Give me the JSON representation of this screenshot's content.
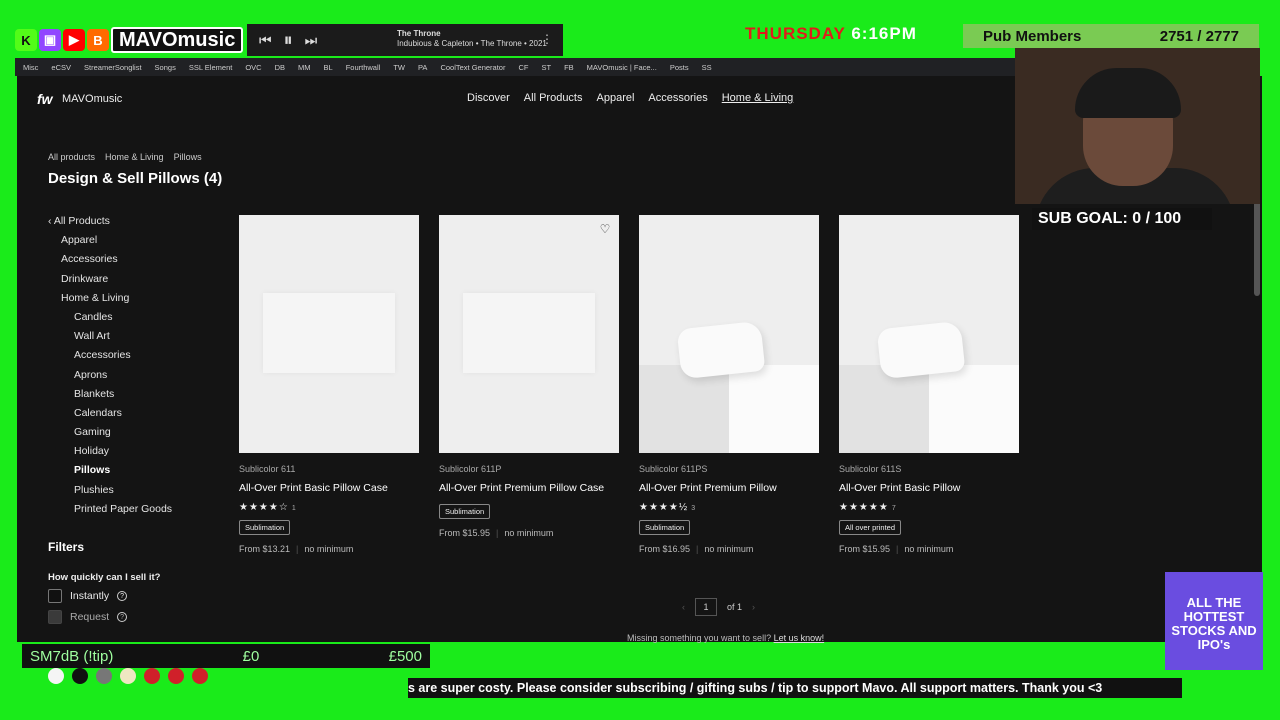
{
  "overlay": {
    "brand": "MAVOmusic",
    "player": {
      "song_title": "The Throne",
      "song_artist": "Indubious & Capleton • The Throne • 2021"
    },
    "clock": {
      "day": "THURSDAY",
      "time": "6:16PM"
    },
    "pub_members": {
      "label": "Pub Members",
      "count": "2751 / 2777"
    },
    "sub_goal": "SUB GOAL: 0 / 100",
    "ad_text": "ALL THE HOTTEST STOCKS AND IPO's",
    "tip": {
      "label": "SM7dB (!tip)",
      "current": "£0",
      "goal": "£500"
    },
    "ticker": "s are super costy. Please consider subscribing / gifting subs / tip to support Mavo. All support matters. Thank you <3",
    "dot_colors": [
      "#f5f5f5",
      "#111111",
      "#777777",
      "#efe7c2",
      "#d0202a",
      "#d0202a",
      "#d0202a"
    ]
  },
  "bookmarks": [
    "Misc",
    "eCSV",
    "StreamerSonglist",
    "Songs",
    "SSL Element",
    "OVC",
    "DB",
    "MM",
    "BL",
    "Fourthwall",
    "TW",
    "PA",
    "CoolText Generator",
    "CF",
    "ST",
    "FB",
    "MAVOmusic | Face...",
    "Posts",
    "SS"
  ],
  "site": {
    "logo": "fw",
    "store_name": "MAVOmusic",
    "nav": [
      "Discover",
      "All Products",
      "Apparel",
      "Accessories",
      "Home & Living"
    ],
    "breadcrumbs": [
      "All products",
      "Home & Living",
      "Pillows"
    ],
    "page_title": "Design & Sell Pillows (4)"
  },
  "sidebar": {
    "back": "All Products",
    "top": [
      "Apparel",
      "Accessories",
      "Drinkware",
      "Home & Living"
    ],
    "sub": [
      "Candles",
      "Wall Art",
      "Accessories",
      "Aprons",
      "Blankets",
      "Calendars",
      "Gaming",
      "Holiday",
      "Pillows",
      "Plushies",
      "Printed Paper Goods"
    ],
    "active": "Pillows"
  },
  "filters": {
    "title": "Filters",
    "question": "How quickly can I sell it?",
    "options": [
      "Instantly",
      "Request"
    ]
  },
  "products": [
    {
      "sku": "Sublicolor 611",
      "name": "All-Over Print Basic Pillow Case",
      "stars": "★★★★☆",
      "rating": 4,
      "reviews": "1",
      "tag": "Sublimation",
      "price": "From $13.21",
      "minimum": "no minimum"
    },
    {
      "sku": "Sublicolor 611P",
      "name": "All-Over Print Premium Pillow Case",
      "stars": "",
      "reviews": "",
      "tag": "Sublimation",
      "price": "From $15.95",
      "minimum": "no minimum"
    },
    {
      "sku": "Sublicolor 611PS",
      "name": "All-Over Print Premium Pillow",
      "stars": "★★★★½",
      "rating": 4.5,
      "reviews": "3",
      "tag": "Sublimation",
      "price": "From $16.95",
      "minimum": "no minimum"
    },
    {
      "sku": "Sublicolor 611S",
      "name": "All-Over Print Basic Pillow",
      "stars": "★★★★★",
      "rating": 5,
      "reviews": "7",
      "tag": "All over printed",
      "price": "From $15.95",
      "minimum": "no minimum"
    }
  ],
  "pager": {
    "current": "1",
    "of": "of 1"
  },
  "missing": {
    "text": "Missing something you want to sell?",
    "link": "Let us know!"
  }
}
